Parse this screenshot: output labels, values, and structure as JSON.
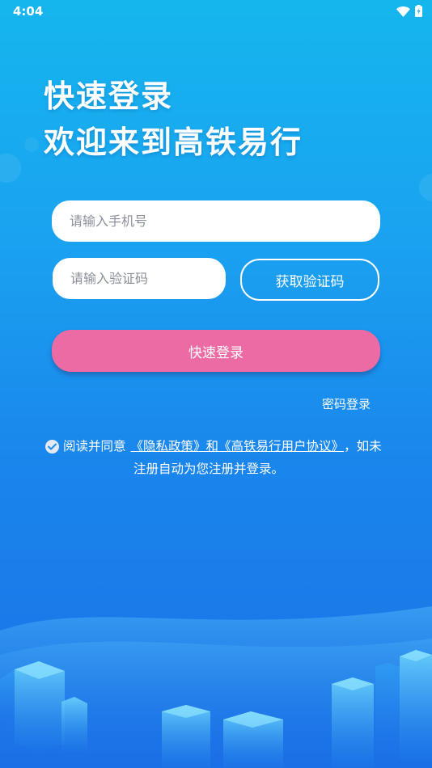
{
  "status_bar": {
    "time": "4:04",
    "wifi_icon": "wifi-icon",
    "battery_icon": "battery-charging-icon"
  },
  "title": {
    "line1": "快速登录",
    "line2": "欢迎来到高铁易行"
  },
  "form": {
    "phone_placeholder": "请输入手机号",
    "code_placeholder": "请输入验证码",
    "get_code_label": "获取验证码",
    "login_label": "快速登录",
    "password_login_label": "密码登录"
  },
  "agreement": {
    "prefix": "阅读并同意",
    "privacy_link": "《隐私政策》",
    "conjunction": "和",
    "user_agreement_link": "《高铁易行用户协议》",
    "suffix": "，如未",
    "line2": "注册自动为您注册并登录。",
    "check_icon": "check-circle-icon"
  },
  "colors": {
    "background_top": "#15b6ee",
    "background_bottom": "#1b6fe6",
    "login_button": "#ec6ba5"
  }
}
